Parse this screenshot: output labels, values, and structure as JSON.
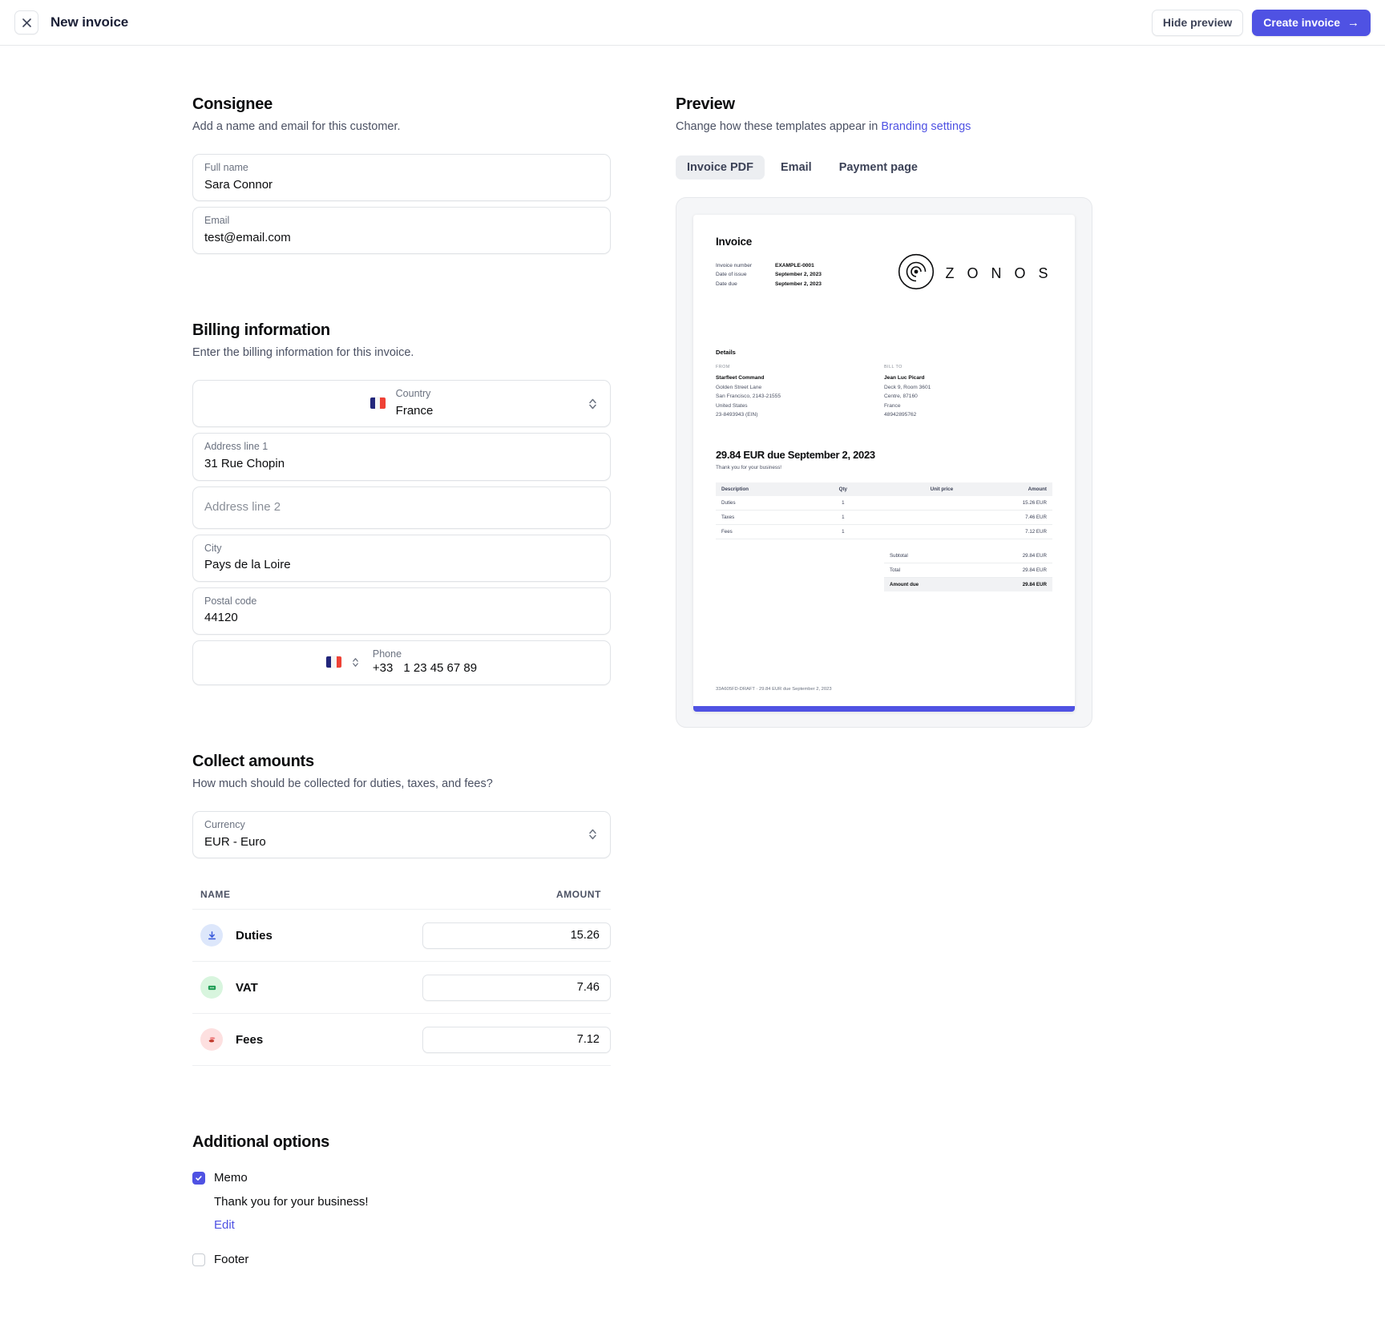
{
  "topbar": {
    "close_icon": "close-icon",
    "title": "New invoice",
    "hide_preview_label": "Hide preview",
    "create_invoice_label": "Create invoice",
    "create_invoice_arrow": "→",
    "primary_color": "#4f52e3"
  },
  "consignee": {
    "title": "Consignee",
    "subtitle": "Add a name and email for this customer.",
    "fields": [
      {
        "label": "Full name",
        "value": "Sara Connor"
      },
      {
        "label": "Email",
        "value": "test@email.com"
      }
    ]
  },
  "billing": {
    "title": "Billing information",
    "subtitle": "Enter the billing information for this invoice.",
    "country": {
      "label": "Country",
      "value": "France",
      "flag": "flag-france-icon"
    },
    "address1": {
      "label": "Address line 1",
      "value": "31 Rue Chopin"
    },
    "address2": {
      "placeholder": "Address line 2",
      "value": ""
    },
    "city": {
      "label": "City",
      "value": "Pays de la Loire"
    },
    "postal": {
      "label": "Postal code",
      "value": "44120"
    },
    "phone": {
      "label": "Phone",
      "dial_code": "+33",
      "value": "1 23 45 67 89",
      "flag": "flag-france-icon"
    }
  },
  "collect": {
    "title": "Collect amounts",
    "subtitle": "How much should be collected for duties, taxes, and fees?",
    "currency": {
      "label": "Currency",
      "value": "EUR - Euro"
    },
    "columns": {
      "name": "NAME",
      "amount": "AMOUNT"
    },
    "rows": [
      {
        "icon": "duties-download-icon",
        "name": "Duties",
        "amount": "15.26",
        "icon_bg": "#dde7fb",
        "icon_fg": "#3b5bdb"
      },
      {
        "icon": "vat-banknote-icon",
        "name": "VAT",
        "amount": "7.46",
        "icon_bg": "#d8f5de",
        "icon_fg": "#1f9d55"
      },
      {
        "icon": "fees-coins-icon",
        "name": "Fees",
        "amount": "7.12",
        "icon_bg": "#fde0e0",
        "icon_fg": "#e05252"
      }
    ]
  },
  "additional": {
    "title": "Additional options",
    "memo": {
      "label": "Memo",
      "checked": true,
      "text": "Thank you for your business!",
      "edit_label": "Edit"
    },
    "footer": {
      "label": "Footer",
      "checked": false
    }
  },
  "preview": {
    "title": "Preview",
    "subtitle_prefix": "Change how these templates appear in ",
    "subtitle_link": "Branding settings",
    "tabs": [
      {
        "label": "Invoice PDF",
        "active": true
      },
      {
        "label": "Email",
        "active": false
      },
      {
        "label": "Payment page",
        "active": false
      }
    ],
    "document": {
      "title": "Invoice",
      "meta": [
        {
          "label": "Invoice number",
          "value": "EXAMPLE-0001"
        },
        {
          "label": "Date of issue",
          "value": "September 2, 2023"
        },
        {
          "label": "Date due",
          "value": "September 2, 2023"
        }
      ],
      "logo_text": "Z O N O S",
      "details_heading": "Details",
      "from": {
        "caption": "FROM",
        "name": "Starfleet Command",
        "lines": [
          "Golden Street Lane",
          "San Francisco, 2143-21555",
          "United States",
          "23-8493943 (EIN)"
        ]
      },
      "bill_to": {
        "caption": "BILL TO",
        "name": "Jean Luc Picard",
        "lines": [
          "Deck 9, Room 3601",
          "Centre, 87160",
          "France",
          "48942895762"
        ]
      },
      "due_heading": "29.84 EUR due September 2, 2023",
      "memo": "Thank you for your business!",
      "table": {
        "headers": [
          "Description",
          "Qty",
          "Unit price",
          "Amount"
        ],
        "rows": [
          {
            "description": "Duties",
            "qty": "1",
            "unit_price": "",
            "amount": "15.26 EUR"
          },
          {
            "description": "Taxes",
            "qty": "1",
            "unit_price": "",
            "amount": "7.46 EUR"
          },
          {
            "description": "Fees",
            "qty": "1",
            "unit_price": "",
            "amount": "7.12 EUR"
          }
        ]
      },
      "totals": [
        {
          "label": "Subtotal",
          "value": "29.84 EUR",
          "emphasis": false
        },
        {
          "label": "Total",
          "value": "29.84 EUR",
          "emphasis": false
        },
        {
          "label": "Amount due",
          "value": "29.84 EUR",
          "emphasis": true
        }
      ],
      "footer_text": "33A605FD-DRAFT · 29.84 EUR due September 2, 2023"
    }
  }
}
